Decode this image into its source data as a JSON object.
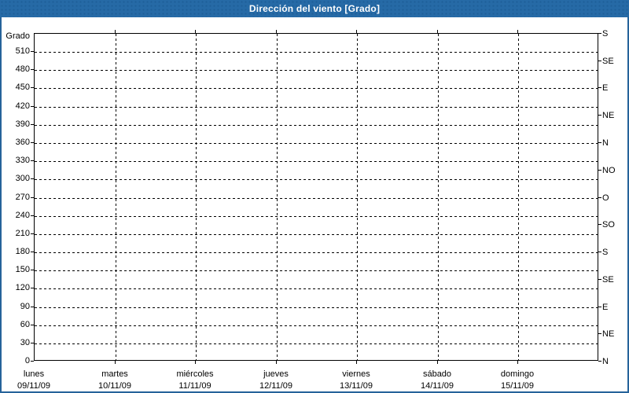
{
  "title": "Dirección del viento [Grado]",
  "colors": {
    "titlebar_bg": "#266aa6",
    "titlebar_text": "#ffffff",
    "window_border": "#26639a",
    "plot_border": "#000000",
    "grid": "#000000",
    "label_text": "#000000",
    "background": "#ffffff"
  },
  "chart_data": {
    "type": "line",
    "title": "Dirección del viento [Grado]",
    "series": [],
    "grid": {
      "style": "dashed",
      "horizontal_step_deg": 30,
      "vertical": "day-boundaries"
    },
    "y_axis_left": {
      "label": "Grado",
      "min": 0,
      "max": 540,
      "tick_step": 30,
      "tick_labels": [
        "0",
        "30",
        "60",
        "90",
        "120",
        "150",
        "180",
        "210",
        "240",
        "270",
        "300",
        "330",
        "360",
        "390",
        "420",
        "450",
        "480",
        "510"
      ]
    },
    "y_axis_right": {
      "tick_step": 45,
      "tick_labels_bottom_to_top": [
        "N",
        "NE",
        "E",
        "SE",
        "S",
        "SO",
        "O",
        "NO",
        "N",
        "NE",
        "E",
        "SE",
        "S"
      ]
    },
    "x_axis": {
      "days": [
        {
          "name": "lunes",
          "date": "09/11/09"
        },
        {
          "name": "martes",
          "date": "10/11/09"
        },
        {
          "name": "miércoles",
          "date": "11/11/09"
        },
        {
          "name": "jueves",
          "date": "12/11/09"
        },
        {
          "name": "viernes",
          "date": "13/11/09"
        },
        {
          "name": "sábado",
          "date": "14/11/09"
        },
        {
          "name": "domingo",
          "date": "15/11/09"
        }
      ]
    }
  }
}
